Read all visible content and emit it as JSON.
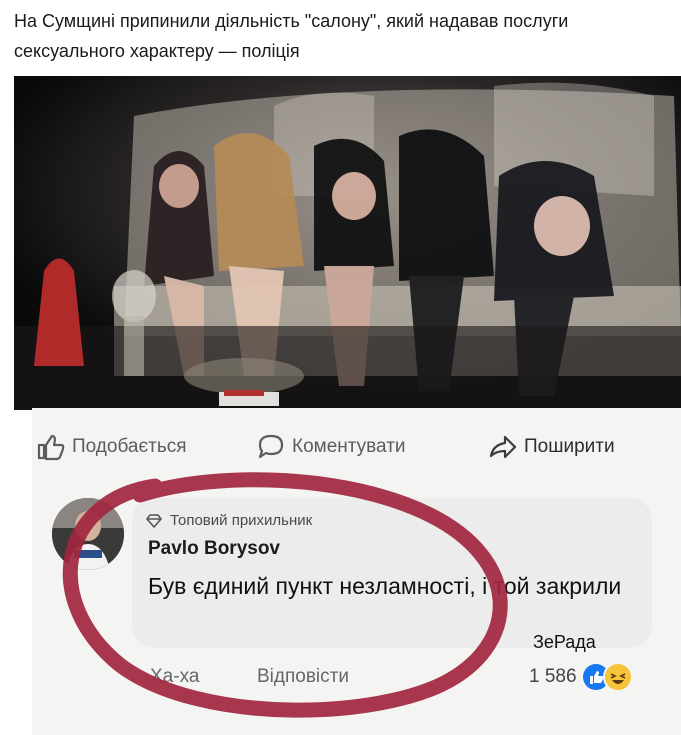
{
  "article": {
    "headline": "На Сумщині припинили діяльність \"салону\", який надавав послуги сексуального характеру — поліція"
  },
  "post_actions": {
    "like_label": "Подобається",
    "comment_label": "Коментувати",
    "share_label": "Поширити",
    "like_icon": "thumbs-up-icon",
    "comment_icon": "comment-bubble-icon",
    "share_icon": "share-arrow-icon"
  },
  "comment": {
    "badge": "Топовий прихильник",
    "badge_icon": "diamond-icon",
    "author": "Pavlo Borysov",
    "text": "Був єдиний пункт незламності, і той закрили",
    "reaction_label": "Ха-ха",
    "reply_label": "Відповісти",
    "reaction_count": "1 586",
    "reaction_icons": [
      "like-reaction-icon",
      "haha-reaction-icon"
    ]
  },
  "annotation": {
    "tag": "ЗеРада",
    "circle_color": "#a1263f"
  }
}
